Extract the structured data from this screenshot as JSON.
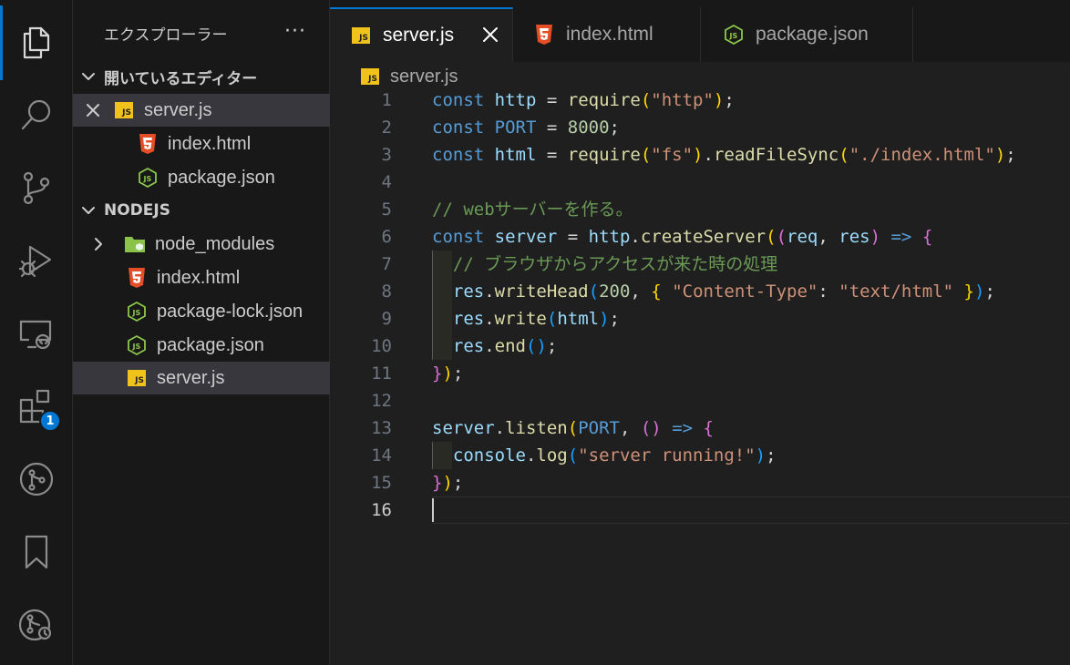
{
  "sidebar": {
    "title": "エクスプローラー",
    "more": "···",
    "open_editors_header": "開いているエディター",
    "open_editors": [
      {
        "name": "server.js",
        "icon": "js"
      },
      {
        "name": "index.html",
        "icon": "html"
      },
      {
        "name": "package.json",
        "icon": "json"
      }
    ],
    "project_header": "NODEJS",
    "files": [
      {
        "name": "node_modules",
        "icon": "folder"
      },
      {
        "name": "index.html",
        "icon": "html"
      },
      {
        "name": "package-lock.json",
        "icon": "json"
      },
      {
        "name": "package.json",
        "icon": "json"
      },
      {
        "name": "server.js",
        "icon": "js"
      }
    ]
  },
  "activity_bar": {
    "icons": [
      "files-icon",
      "search-icon",
      "source-control-icon",
      "run-debug-icon",
      "remote-explorer-icon",
      "extensions-icon",
      "git-graph-icon",
      "bookmarks-icon",
      "git-history-icon"
    ],
    "extensions_badge": "1"
  },
  "tabs": [
    {
      "label": "server.js",
      "icon": "js",
      "active": true
    },
    {
      "label": "index.html",
      "icon": "html",
      "active": false
    },
    {
      "label": "package.json",
      "icon": "json",
      "active": false
    }
  ],
  "breadcrumb": {
    "file": "server.js"
  },
  "editor": {
    "current_line": 16,
    "line_numbers": [
      "1",
      "2",
      "3",
      "4",
      "5",
      "6",
      "7",
      "8",
      "9",
      "10",
      "11",
      "12",
      "13",
      "14",
      "15",
      "16"
    ],
    "lines": [
      [
        [
          "kw",
          "const"
        ],
        [
          "op",
          " "
        ],
        [
          "vr",
          "http"
        ],
        [
          "op",
          " = "
        ],
        [
          "fn",
          "require"
        ],
        [
          "p1",
          "("
        ],
        [
          "st",
          "\"http\""
        ],
        [
          "p1",
          ")"
        ],
        [
          "op",
          ";"
        ]
      ],
      [
        [
          "kw",
          "const"
        ],
        [
          "op",
          " "
        ],
        [
          "kw",
          "PORT"
        ],
        [
          "op",
          " = "
        ],
        [
          "nm",
          "8000"
        ],
        [
          "op",
          ";"
        ]
      ],
      [
        [
          "kw",
          "const"
        ],
        [
          "op",
          " "
        ],
        [
          "vr",
          "html"
        ],
        [
          "op",
          " = "
        ],
        [
          "fn",
          "require"
        ],
        [
          "p1",
          "("
        ],
        [
          "st",
          "\"fs\""
        ],
        [
          "p1",
          ")"
        ],
        [
          "op",
          "."
        ],
        [
          "fn",
          "readFileSync"
        ],
        [
          "p1",
          "("
        ],
        [
          "st",
          "\"./index.html\""
        ],
        [
          "p1",
          ")"
        ],
        [
          "op",
          ";"
        ]
      ],
      [],
      [
        [
          "cm",
          "// webサーバーを作る。"
        ]
      ],
      [
        [
          "kw",
          "const"
        ],
        [
          "op",
          " "
        ],
        [
          "vr",
          "server"
        ],
        [
          "op",
          " = "
        ],
        [
          "vr",
          "http"
        ],
        [
          "op",
          "."
        ],
        [
          "fn",
          "createServer"
        ],
        [
          "p1",
          "("
        ],
        [
          "p2",
          "("
        ],
        [
          "vr",
          "req"
        ],
        [
          "op",
          ", "
        ],
        [
          "vr",
          "res"
        ],
        [
          "p2",
          ")"
        ],
        [
          "op",
          " "
        ],
        [
          "kw",
          "=>"
        ],
        [
          "op",
          " "
        ],
        [
          "p2",
          "{"
        ]
      ],
      [
        [
          "op",
          "  "
        ],
        [
          "cm",
          "// ブラウザからアクセスが来た時の処理"
        ]
      ],
      [
        [
          "op",
          "  "
        ],
        [
          "vr",
          "res"
        ],
        [
          "op",
          "."
        ],
        [
          "fn",
          "writeHead"
        ],
        [
          "p3",
          "("
        ],
        [
          "nm",
          "200"
        ],
        [
          "op",
          ", "
        ],
        [
          "p1",
          "{"
        ],
        [
          "op",
          " "
        ],
        [
          "st",
          "\"Content-Type\""
        ],
        [
          "op",
          ": "
        ],
        [
          "st",
          "\"text/html\""
        ],
        [
          "op",
          " "
        ],
        [
          "p1",
          "}"
        ],
        [
          "p3",
          ")"
        ],
        [
          "op",
          ";"
        ]
      ],
      [
        [
          "op",
          "  "
        ],
        [
          "vr",
          "res"
        ],
        [
          "op",
          "."
        ],
        [
          "fn",
          "write"
        ],
        [
          "p3",
          "("
        ],
        [
          "vr",
          "html"
        ],
        [
          "p3",
          ")"
        ],
        [
          "op",
          ";"
        ]
      ],
      [
        [
          "op",
          "  "
        ],
        [
          "vr",
          "res"
        ],
        [
          "op",
          "."
        ],
        [
          "fn",
          "end"
        ],
        [
          "p3",
          "()"
        ],
        [
          "op",
          ";"
        ]
      ],
      [
        [
          "p2",
          "}"
        ],
        [
          "p1",
          ")"
        ],
        [
          "op",
          ";"
        ]
      ],
      [],
      [
        [
          "vr",
          "server"
        ],
        [
          "op",
          "."
        ],
        [
          "fn",
          "listen"
        ],
        [
          "p1",
          "("
        ],
        [
          "kw",
          "PORT"
        ],
        [
          "op",
          ", "
        ],
        [
          "p2",
          "()"
        ],
        [
          "op",
          " "
        ],
        [
          "kw",
          "=>"
        ],
        [
          "op",
          " "
        ],
        [
          "p2",
          "{"
        ]
      ],
      [
        [
          "op",
          "  "
        ],
        [
          "vr",
          "console"
        ],
        [
          "op",
          "."
        ],
        [
          "fn",
          "log"
        ],
        [
          "p3",
          "("
        ],
        [
          "st",
          "\"server running!\""
        ],
        [
          "p3",
          ")"
        ],
        [
          "op",
          ";"
        ]
      ],
      [
        [
          "p2",
          "}"
        ],
        [
          "p1",
          ")"
        ],
        [
          "op",
          ";"
        ]
      ],
      []
    ]
  }
}
